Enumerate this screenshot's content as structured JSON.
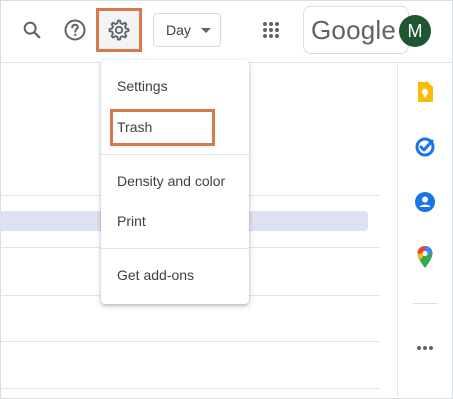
{
  "header": {
    "view_selector": {
      "value": "Day"
    },
    "account": {
      "brand_text": "Google",
      "avatar_initial": "M",
      "avatar_color": "#1e5631"
    }
  },
  "settings_menu": {
    "items": [
      {
        "label": "Settings"
      },
      {
        "label": "Trash"
      },
      {
        "label": "Density and color"
      },
      {
        "label": "Print"
      },
      {
        "label": "Get add-ons"
      }
    ]
  },
  "side_panel": {
    "icons": [
      "keep-icon",
      "tasks-icon",
      "contacts-icon",
      "maps-icon",
      "more-icon"
    ]
  },
  "colors": {
    "highlight_outline": "#d9784b",
    "event_bar": "#dde1f3"
  }
}
